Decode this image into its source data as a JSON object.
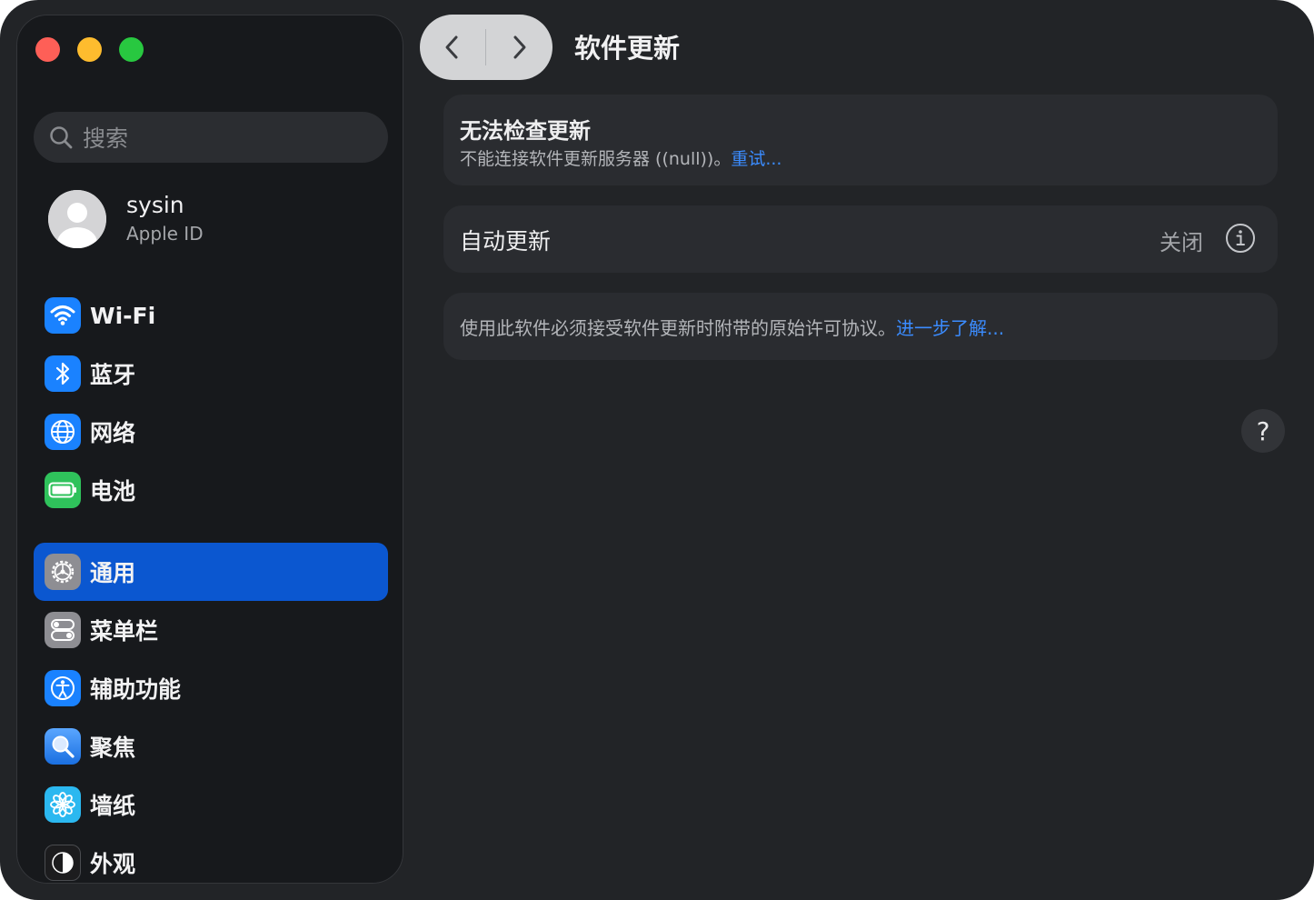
{
  "window": {
    "page_title": "软件更新"
  },
  "sidebar": {
    "search_placeholder": "搜索",
    "user": {
      "name": "sysin",
      "subtitle": "Apple ID"
    },
    "items": [
      {
        "label": "Wi-Fi",
        "icon": "wifi-icon",
        "color": "#1a82ff"
      },
      {
        "label": "蓝牙",
        "icon": "bluetooth-icon",
        "color": "#1a82ff"
      },
      {
        "label": "网络",
        "icon": "globe-icon",
        "color": "#1a82ff"
      },
      {
        "label": "电池",
        "icon": "battery-icon",
        "color": "#2fc25b"
      },
      {
        "label": "通用",
        "icon": "gear-icon",
        "color": "#8e8e93",
        "active": true
      },
      {
        "label": "菜单栏",
        "icon": "menubar-icon",
        "color": "#8e8e93"
      },
      {
        "label": "辅助功能",
        "icon": "accessibility-icon",
        "color": "#1a82ff"
      },
      {
        "label": "聚焦",
        "icon": "spotlight-icon",
        "color": "#1a82ff"
      },
      {
        "label": "墙纸",
        "icon": "wallpaper-icon",
        "color": "#2bb8f0"
      },
      {
        "label": "外观",
        "icon": "appearance-icon",
        "color": "#1c1c1e"
      }
    ]
  },
  "main": {
    "check_error": {
      "title": "无法检查更新",
      "description": "不能连接软件更新服务器 ((null))。",
      "retry_link": "重试..."
    },
    "auto_update": {
      "label": "自动更新",
      "value": "关闭"
    },
    "license": {
      "text": "使用此软件必须接受软件更新时附带的原始许可协议。",
      "learn_more_link": "进一步了解..."
    },
    "help_label": "?"
  },
  "colors": {
    "accent": "#0b57d0",
    "link": "#3b8cff",
    "window_bg": "#222427",
    "sidebar_bg": "#17191c"
  }
}
